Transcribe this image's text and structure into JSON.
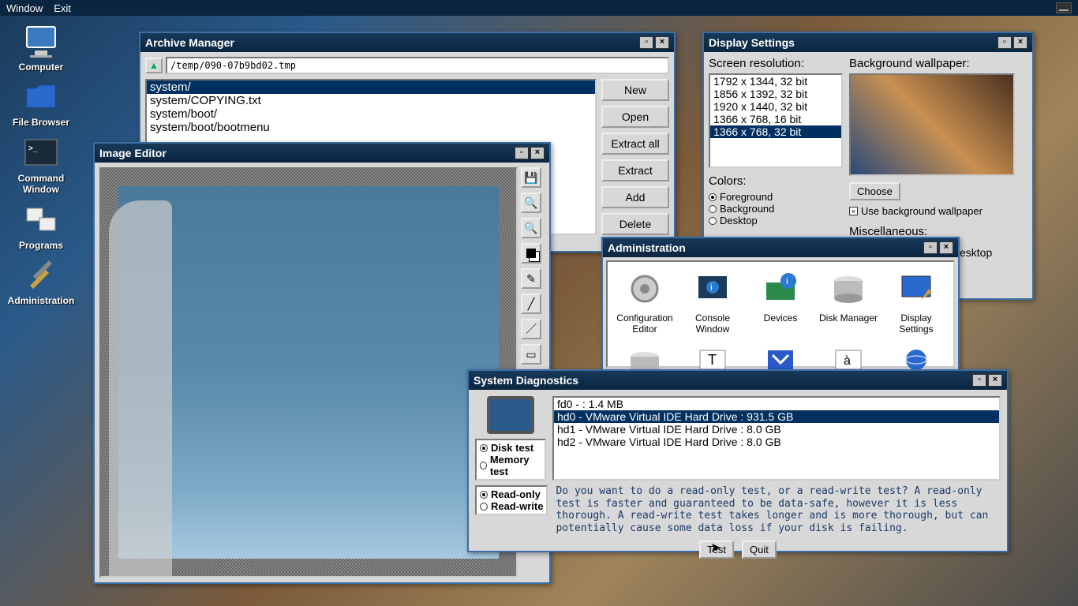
{
  "menubar": {
    "window": "Window",
    "exit": "Exit"
  },
  "desktop": [
    {
      "name": "computer",
      "label": "Computer"
    },
    {
      "name": "file-browser",
      "label": "File Browser"
    },
    {
      "name": "command-window",
      "label": "Command\nWindow"
    },
    {
      "name": "programs",
      "label": "Programs"
    },
    {
      "name": "administration",
      "label": "Administration"
    }
  ],
  "archive": {
    "title": "Archive Manager",
    "path": "/temp/090-07b9bd02.tmp",
    "items": [
      "system/",
      "system/COPYING.txt",
      "system/boot/",
      "system/boot/bootmenu"
    ],
    "selected": 0,
    "buttons": {
      "new": "New",
      "open": "Open",
      "extract_all": "Extract all",
      "extract": "Extract",
      "add": "Add",
      "delete": "Delete"
    }
  },
  "image_editor": {
    "title": "Image Editor"
  },
  "display": {
    "title": "Display Settings",
    "res_label": "Screen resolution:",
    "resolutions": [
      "1792 x 1344, 32 bit",
      "1856 x 1392, 32 bit",
      "1920 x 1440, 32 bit",
      "1366 x 768, 16 bit",
      "1366 x 768, 32 bit"
    ],
    "selected": 4,
    "colors_label": "Colors:",
    "color_opts": {
      "fg": "Foreground",
      "bg": "Background",
      "dt": "Desktop"
    },
    "wall_label": "Background wallpaper:",
    "choose": "Choose",
    "use_wall": "Use background wallpaper",
    "misc_label": "Miscellaneous:",
    "misc_tail": "esktop"
  },
  "admin": {
    "title": "Administration",
    "items": [
      {
        "name": "configuration-editor",
        "label": "Configuration\nEditor"
      },
      {
        "name": "console-window",
        "label": "Console\nWindow"
      },
      {
        "name": "devices",
        "label": "Devices"
      },
      {
        "name": "disk-manager",
        "label": "Disk Manager"
      },
      {
        "name": "display-settings",
        "label": "Display\nSettings"
      }
    ]
  },
  "diag": {
    "title": "System Diagnostics",
    "test_opts": {
      "disk": "Disk test",
      "mem": "Memory test"
    },
    "drives": [
      "fd0 -  : 1.4 MB",
      "hd0 - VMware Virtual IDE Hard Drive : 931.5 GB",
      "hd1 - VMware Virtual IDE Hard Drive : 8.0 GB",
      "hd2 - VMware Virtual IDE Hard Drive : 8.0 GB"
    ],
    "selected": 1,
    "mode": {
      "ro": "Read-only",
      "rw": "Read-write"
    },
    "desc": "Do you want to do a read-only test, or a read-write test?  A read-only test is faster and guaranteed to be data-safe, however it is less thorough.  A read-write test takes longer and is more thorough, but can potentially cause some data loss if your disk is failing.",
    "test": "Test",
    "quit": "Quit"
  }
}
